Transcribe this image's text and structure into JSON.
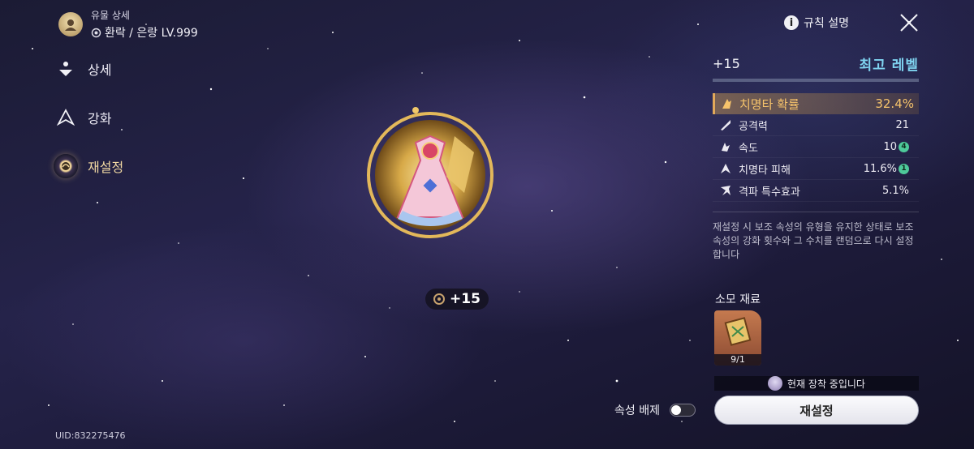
{
  "header": {
    "title": "유물 상세",
    "subtitle": "환락 / 은랑 LV.999"
  },
  "rules_button": {
    "label": "규칙 설명"
  },
  "nav": [
    {
      "label": "상세",
      "active": false
    },
    {
      "label": "강화",
      "active": false
    },
    {
      "label": "재설정",
      "active": true
    }
  ],
  "relic": {
    "level_label": "+15"
  },
  "panel": {
    "enhance_level": "+15",
    "max_level_label": "최고 레벨",
    "main_stat": {
      "name": "치명타 확률",
      "value": "32.4%"
    },
    "sub_stats": [
      {
        "name": "공격력",
        "value": "21",
        "badge": ""
      },
      {
        "name": "속도",
        "value": "10",
        "badge": "4"
      },
      {
        "name": "치명타 피해",
        "value": "11.6%",
        "badge": "1"
      },
      {
        "name": "격파 특수효과",
        "value": "5.1%",
        "badge": ""
      }
    ],
    "description": "재설정 시 보조 속성의 유형을 유지한 상태로 보조 속성의 강화 횟수와 그 수치를 랜덤으로 다시 설정합니다"
  },
  "materials": {
    "title": "소모 재료",
    "count": "9/1"
  },
  "equipped_notice": "현재 장착 중입니다",
  "exclude_toggle": {
    "label": "속성 배제",
    "on": false
  },
  "reset_button": {
    "label": "재설정"
  },
  "uid": "UID:832275476",
  "colors": {
    "accent_gold": "#f6c36b",
    "max_level_blue": "#7fd3f0",
    "badge_green": "#4ec99a"
  }
}
